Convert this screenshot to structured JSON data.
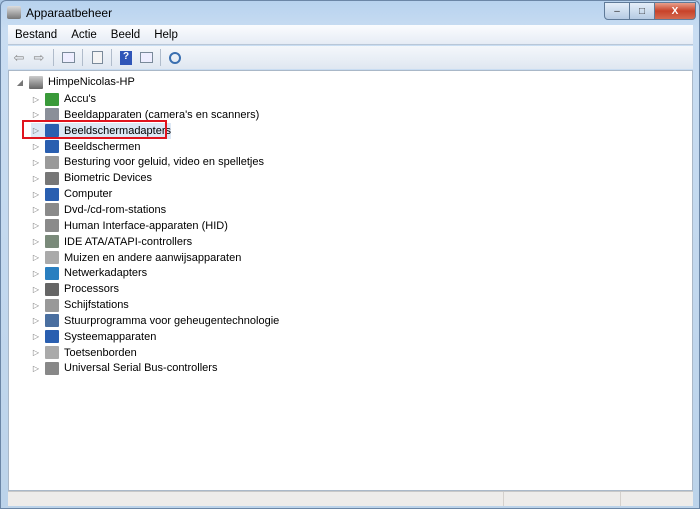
{
  "window": {
    "title": "Apparaatbeheer",
    "minimize": "–",
    "maximize": "□",
    "close": "X"
  },
  "menu": [
    "Bestand",
    "Actie",
    "Beeld",
    "Help"
  ],
  "toolbar": [
    "back-icon",
    "forward-icon",
    "console-tree-icon",
    "properties-icon",
    "help-icon",
    "action-pane-icon",
    "scan-hardware-icon"
  ],
  "tree": {
    "root": "HimpeNicolas-HP",
    "items": [
      {
        "label": "Accu's",
        "color": "#3a9a3a"
      },
      {
        "label": "Beeldapparaten (camera's en scanners)",
        "color": "#8a8f99"
      },
      {
        "label": "Beeldschermadapters",
        "color": "#2a5fb0",
        "highlighted": true
      },
      {
        "label": "Beeldschermen",
        "color": "#2a5fb0"
      },
      {
        "label": "Besturing voor geluid, video en spelletjes",
        "color": "#9a9a9a"
      },
      {
        "label": "Biometric Devices",
        "color": "#777777"
      },
      {
        "label": "Computer",
        "color": "#2a5fb0"
      },
      {
        "label": "Dvd-/cd-rom-stations",
        "color": "#8a8a8a"
      },
      {
        "label": "Human Interface-apparaten (HID)",
        "color": "#8a8a8a"
      },
      {
        "label": "IDE ATA/ATAPI-controllers",
        "color": "#7a8a7a"
      },
      {
        "label": "Muizen en andere aanwijsapparaten",
        "color": "#aaaaaa"
      },
      {
        "label": "Netwerkadapters",
        "color": "#2a7fc0"
      },
      {
        "label": "Processors",
        "color": "#666666"
      },
      {
        "label": "Schijfstations",
        "color": "#999999"
      },
      {
        "label": "Stuurprogramma voor geheugentechnologie",
        "color": "#4a6fa0"
      },
      {
        "label": "Systeemapparaten",
        "color": "#2a5fb0"
      },
      {
        "label": "Toetsenborden",
        "color": "#aaaaaa"
      },
      {
        "label": "Universal Serial Bus-controllers",
        "color": "#888888"
      }
    ]
  }
}
